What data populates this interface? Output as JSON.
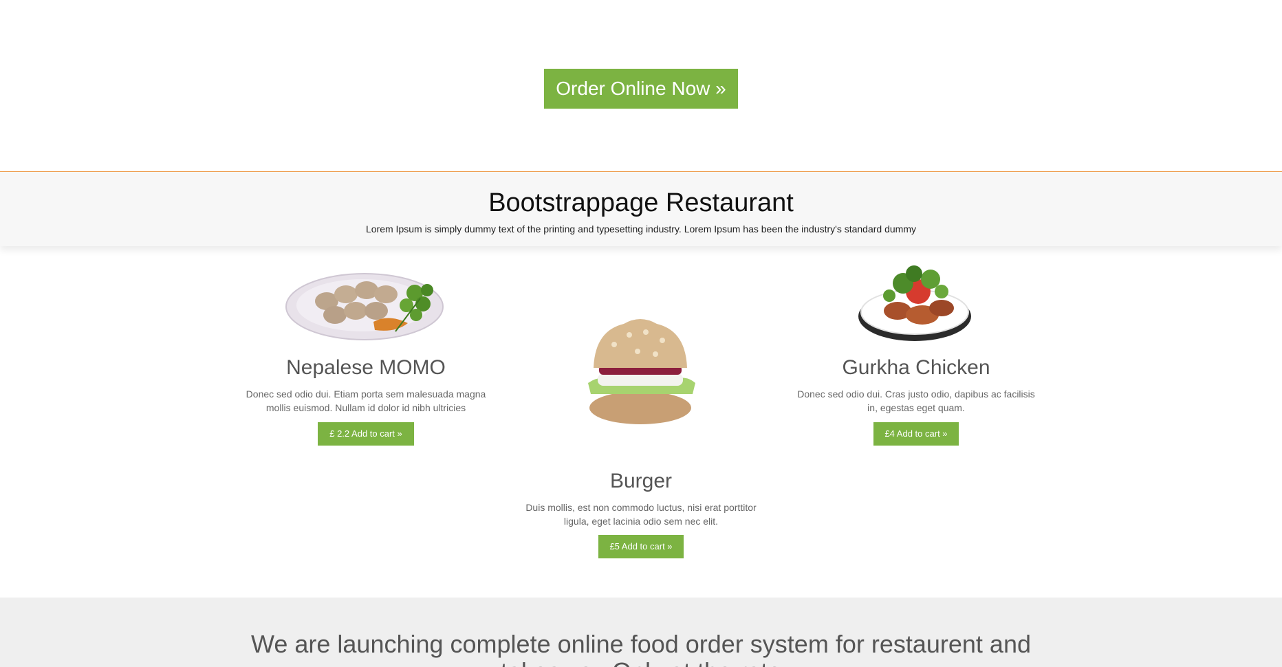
{
  "hero": {
    "order_button": "Order Online Now »"
  },
  "intro": {
    "title": "Bootstrappage Restaurant",
    "text": "Lorem Ipsum is simply dummy text of the printing and typesetting industry. Lorem Ipsum has been the industry's standard dummy"
  },
  "menu": {
    "items": [
      {
        "name": "Nepalese MOMO",
        "description": "Donec sed odio dui. Etiam porta sem malesuada magna mollis euismod. Nullam id dolor id nibh ultricies",
        "button": "£ 2.2 Add to cart »",
        "image": "momo-plate-image"
      },
      {
        "name": "Burger",
        "description": "Duis mollis, est non commodo luctus, nisi erat porttitor ligula, eget lacinia odio sem nec elit.",
        "button": "£5 Add to cart »",
        "image": "burger-image"
      },
      {
        "name": "Gurkha Chicken",
        "description": "Donec sed odio dui. Cras justo odio, dapibus ac facilisis in, egestas eget quam.",
        "button": "£4 Add to cart »",
        "image": "chicken-plate-image"
      }
    ]
  },
  "launch": {
    "text": "We are launching complete online food order system for restaurent and takeaway Only at the rate"
  },
  "colors": {
    "accent_green": "#7cb342",
    "divider_orange": "#f0a050",
    "intro_bg": "#f7f7f7",
    "launch_bg": "#efefef"
  }
}
